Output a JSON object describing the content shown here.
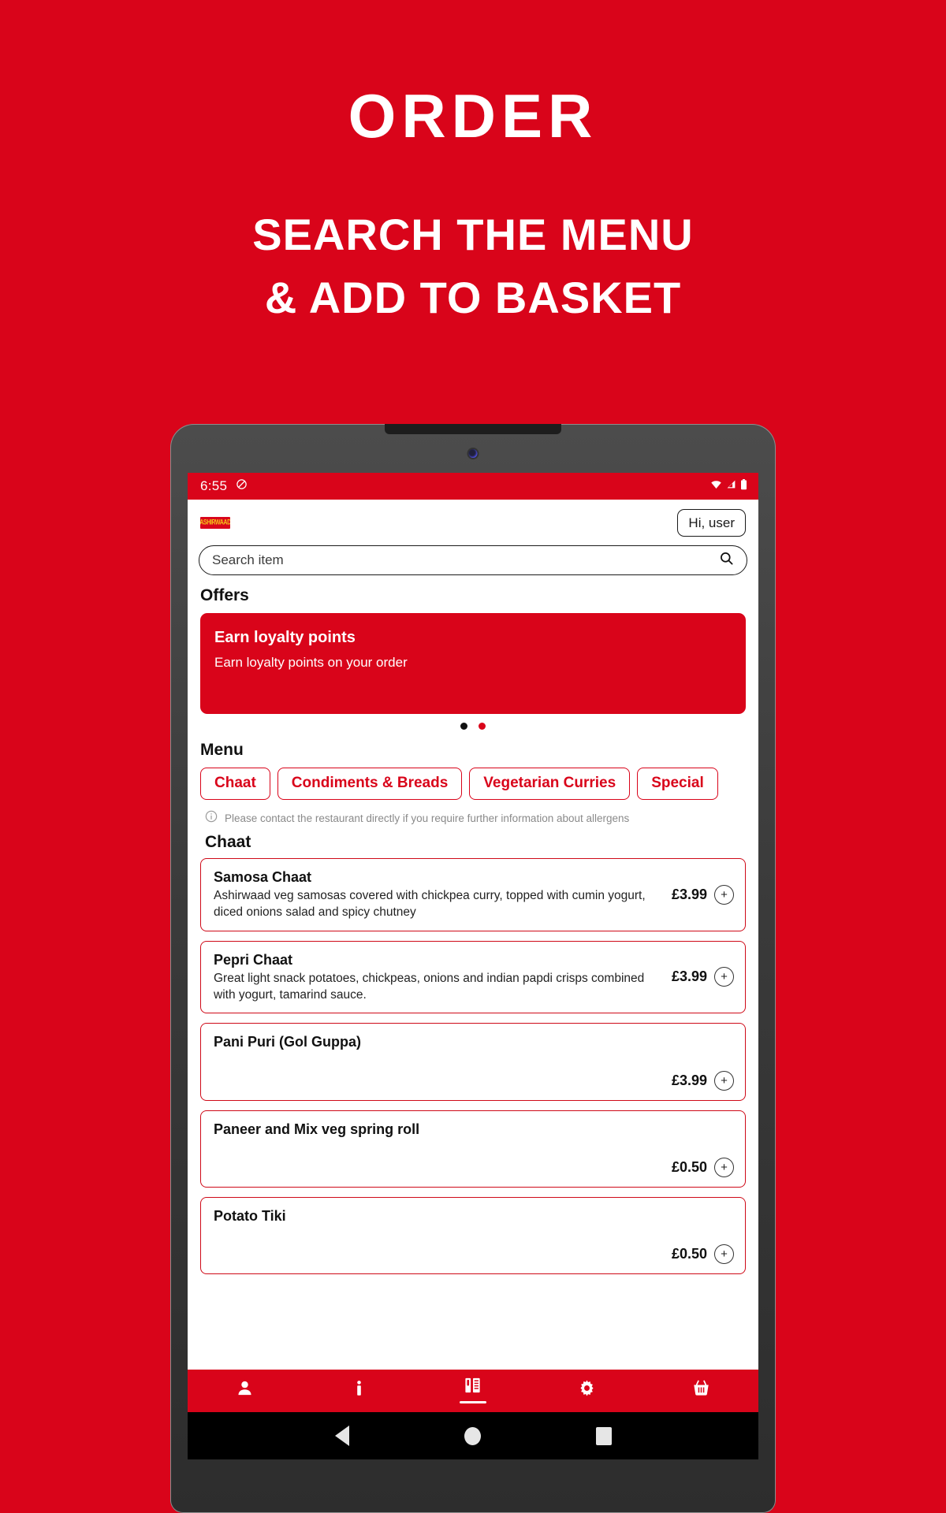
{
  "promo": {
    "title": "ORDER",
    "subtitle_line1": "SEARCH THE MENU",
    "subtitle_line2": "& ADD TO BASKET"
  },
  "colors": {
    "brand_red": "#d9041a",
    "card_border_red": "#cf0a18",
    "white": "#ffffff",
    "text_dark": "#111111",
    "muted_gray": "#8a8a8a"
  },
  "statusbar": {
    "time": "6:55",
    "dnd_icon": "do-not-disturb-icon",
    "wifi_icon": "wifi-icon",
    "signal_icon": "cellular-signal-icon",
    "battery_icon": "battery-icon"
  },
  "header": {
    "logo_text": "ASHIRWAAD",
    "greeting_label": "Hi, user"
  },
  "search": {
    "placeholder": "Search item",
    "icon": "search-icon"
  },
  "offers": {
    "heading": "Offers",
    "cards": [
      {
        "title": "Earn loyalty points",
        "subtitle": "Earn loyalty points on your order"
      }
    ],
    "dots": [
      {
        "name": "carousel-dot-1",
        "color": "#111111"
      },
      {
        "name": "carousel-dot-2",
        "color": "#d9041a"
      }
    ]
  },
  "menu": {
    "heading": "Menu",
    "categories": [
      {
        "label": "Chaat"
      },
      {
        "label": "Condiments & Breads"
      },
      {
        "label": "Vegetarian Curries"
      },
      {
        "label": "Special"
      }
    ],
    "allergen_notice": "Please contact the restaurant directly if you require further information about allergens",
    "allergen_icon": "info-icon",
    "group_title": "Chaat",
    "items": [
      {
        "name": "Samosa Chaat",
        "description": "Ashirwaad veg samosas covered with chickpea curry, topped with cumin yogurt, diced onions salad and spicy chutney",
        "price": "£3.99",
        "add_label": "+"
      },
      {
        "name": "Pepri Chaat",
        "description": "Great light snack potatoes, chickpeas, onions and indian papdi crisps combined with yogurt, tamarind sauce.",
        "price": "£3.99",
        "add_label": "+"
      },
      {
        "name": "Pani Puri (Gol Guppa)",
        "description": "",
        "price": "£3.99",
        "add_label": "+"
      },
      {
        "name": "Paneer and Mix veg spring roll",
        "description": "",
        "price": "£0.50",
        "add_label": "+"
      },
      {
        "name": "Potato Tiki",
        "description": "",
        "price": "£0.50",
        "add_label": "+"
      }
    ]
  },
  "bottom_nav": [
    {
      "name": "nav-account",
      "icon": "person-icon",
      "active": false
    },
    {
      "name": "nav-info",
      "icon": "info-icon",
      "active": false
    },
    {
      "name": "nav-menu",
      "icon": "menu-board-icon",
      "active": true
    },
    {
      "name": "nav-settings",
      "icon": "gear-icon",
      "active": false
    },
    {
      "name": "nav-basket",
      "icon": "basket-icon",
      "active": false
    }
  ],
  "system_nav": {
    "back": "back-triangle-icon",
    "home": "home-circle-icon",
    "recents": "recents-square-icon"
  }
}
